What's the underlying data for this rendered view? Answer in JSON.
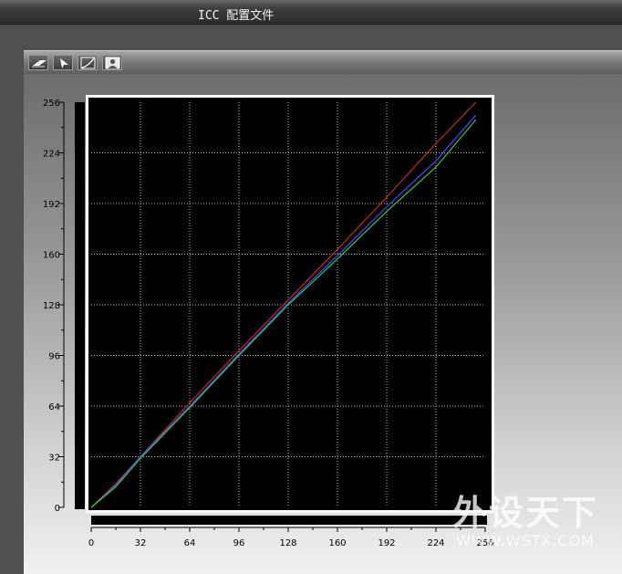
{
  "window": {
    "title": "ICC 配置文件"
  },
  "toolbar": {
    "buttons": [
      {
        "icon": "eraser-icon"
      },
      {
        "icon": "pointer-icon"
      },
      {
        "icon": "curve-icon"
      },
      {
        "icon": "portrait-icon"
      }
    ]
  },
  "chart_data": {
    "type": "line",
    "title": "",
    "xlabel": "",
    "ylabel": "",
    "xlim": [
      0,
      256
    ],
    "ylim": [
      0,
      256
    ],
    "grid": true,
    "x_ticks": [
      "0",
      "32",
      "64",
      "96",
      "128",
      "160",
      "192",
      "224",
      "256"
    ],
    "y_ticks": [
      "0",
      "32",
      "64",
      "96",
      "128",
      "160",
      "192",
      "224",
      "256"
    ],
    "series": [
      {
        "color": "#cc2a2a",
        "x": [
          0,
          16,
          32,
          64,
          96,
          128,
          160,
          192,
          224,
          250
        ],
        "y": [
          0,
          15,
          32,
          66,
          99,
          131,
          163,
          196,
          230,
          256
        ]
      },
      {
        "color": "#4a4aff",
        "x": [
          0,
          16,
          32,
          64,
          96,
          128,
          160,
          192,
          224,
          250
        ],
        "y": [
          0,
          14,
          32,
          64,
          97,
          129,
          159,
          190,
          219,
          248
        ]
      },
      {
        "color": "#33cc44",
        "x": [
          0,
          16,
          32,
          64,
          96,
          128,
          160,
          192,
          224,
          250
        ],
        "y": [
          0,
          13,
          31,
          63,
          96,
          128,
          157,
          187,
          215,
          245
        ]
      }
    ]
  },
  "watermark": {
    "main": "外设天下",
    "sub": "WWW.WSTX.COM"
  }
}
